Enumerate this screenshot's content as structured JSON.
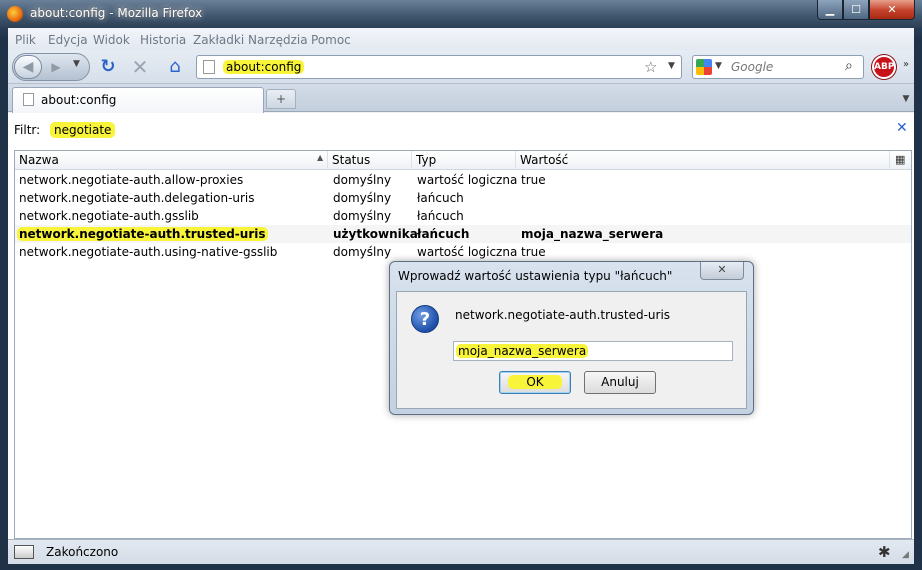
{
  "window": {
    "title": "about:config - Mozilla Firefox",
    "min": "▁",
    "max": "☐",
    "close": "✕"
  },
  "menu": [
    "Plik",
    "Edycja",
    "Widok",
    "Historia",
    "Zakładki",
    "Narzędzia",
    "Pomoc"
  ],
  "nav": {
    "url": "about:config",
    "search_placeholder": "Google"
  },
  "tab": {
    "label": "about:config",
    "new_tab": "+"
  },
  "filter": {
    "label": "Filtr:",
    "value": "negotiate"
  },
  "columns": [
    "Nazwa",
    "Status",
    "Typ",
    "Wartość"
  ],
  "rows": [
    {
      "name": "network.negotiate-auth.allow-proxies",
      "status": "domyślny",
      "type": "wartość logiczna",
      "value": "true"
    },
    {
      "name": "network.negotiate-auth.delegation-uris",
      "status": "domyślny",
      "type": "łańcuch",
      "value": ""
    },
    {
      "name": "network.negotiate-auth.gsslib",
      "status": "domyślny",
      "type": "łańcuch",
      "value": ""
    },
    {
      "name": "network.negotiate-auth.trusted-uris",
      "status": "użytkownika",
      "type": "łańcuch",
      "value": "moja_nazwa_serwera"
    },
    {
      "name": "network.negotiate-auth.using-native-gsslib",
      "status": "domyślny",
      "type": "wartość logiczna",
      "value": "true"
    }
  ],
  "dialog": {
    "title": "Wprowadź wartość ustawienia typu \"łańcuch\"",
    "message": "network.negotiate-auth.trusted-uris",
    "input_value": "moja_nazwa_serwera",
    "ok": "OK",
    "cancel": "Anuluj"
  },
  "status": {
    "text": "Zakończono"
  },
  "colors": {
    "highlight": "#f7f43a",
    "accent": "#2a63c9"
  }
}
